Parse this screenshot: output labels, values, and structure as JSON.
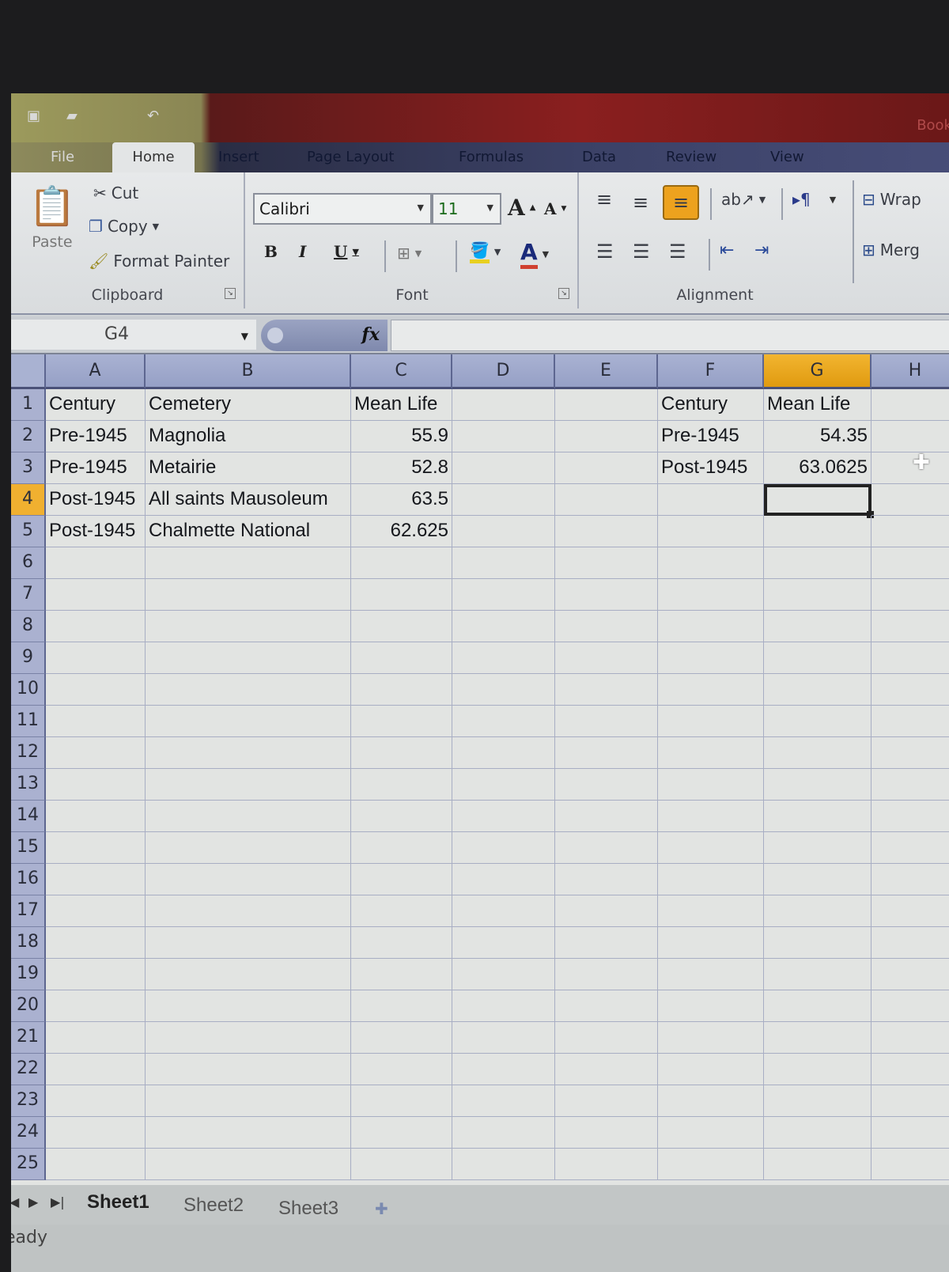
{
  "window": {
    "title_fragment": "Book"
  },
  "ribbon_tabs": [
    {
      "label": "File"
    },
    {
      "label": "Home"
    },
    {
      "label": "Insert"
    },
    {
      "label": "Page Layout"
    },
    {
      "label": "Formulas"
    },
    {
      "label": "Data"
    },
    {
      "label": "Review"
    },
    {
      "label": "View"
    }
  ],
  "clipboard": {
    "paste": "Paste",
    "cut": "Cut",
    "copy": "Copy",
    "format_painter": "Format Painter",
    "group_label": "Clipboard"
  },
  "font": {
    "name": "Calibri",
    "size": "11",
    "group_label": "Font",
    "bold": "B",
    "italic": "I",
    "underline": "U",
    "grow": "A",
    "shrink": "A",
    "color_a": "A"
  },
  "alignment": {
    "group_label": "Alignment",
    "wrap": "Wrap",
    "merge": "Merg"
  },
  "formula_bar": {
    "name_box": "G4",
    "fx": "fx",
    "formula": ""
  },
  "columns": [
    "A",
    "B",
    "C",
    "D",
    "E",
    "F",
    "G",
    "H"
  ],
  "rows": [
    "1",
    "2",
    "3",
    "4",
    "5",
    "6",
    "7",
    "8",
    "9",
    "10",
    "11",
    "12",
    "13",
    "14",
    "15",
    "16",
    "17",
    "18",
    "19",
    "20",
    "21",
    "22",
    "23",
    "24",
    "25"
  ],
  "cells": {
    "A1": "Century",
    "B1": "Cemetery",
    "C1": "Mean Life",
    "A2": "Pre-1945",
    "B2": "Magnolia",
    "C2": "55.9",
    "A3": "Pre-1945",
    "B3": "Metairie",
    "C3": "52.8",
    "A4": "Post-1945",
    "B4": "All saints Mausoleum",
    "C4": "63.5",
    "A5": "Post-1945",
    "B5": "Chalmette National",
    "C5": "62.625",
    "F1": "Century",
    "G1": "Mean Life",
    "F2": "Pre-1945",
    "G2": "54.35",
    "F3": "Post-1945",
    "G3": "63.0625"
  },
  "selection": {
    "active_cell": "G4",
    "column": "G",
    "row": "4"
  },
  "sheets": [
    {
      "label": "Sheet1",
      "active": true
    },
    {
      "label": "Sheet2"
    },
    {
      "label": "Sheet3"
    }
  ],
  "status": {
    "text": "eady"
  },
  "accent": {
    "selection": "#f0b030",
    "header": "#a9b2d2"
  }
}
